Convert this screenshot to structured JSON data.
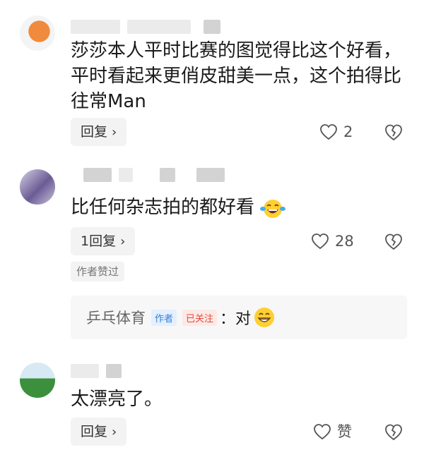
{
  "comments": [
    {
      "content": "莎莎本人平时比赛的图觉得比这个好看，平时看起来更俏皮甜美一点，这个拍得比往常Man",
      "reply_label": "回复",
      "like_count": "2"
    },
    {
      "content": "比任何杂志拍的都好看",
      "emoji": "grinning-sweat-laugh",
      "reply_label": "1回复",
      "like_count": "28",
      "author_liked": "作者赞过",
      "sub_reply": {
        "name": "乒乓体育",
        "author_tag": "作者",
        "follow_tag": "已关注",
        "text": "：对",
        "emoji": "grinning-face"
      }
    },
    {
      "content": "太漂亮了。",
      "reply_label": "回复",
      "like_label": "赞"
    }
  ],
  "icons": {
    "reply_chevron": "›",
    "heart": "heart-outline-icon",
    "dislike": "broken-heart-icon"
  }
}
